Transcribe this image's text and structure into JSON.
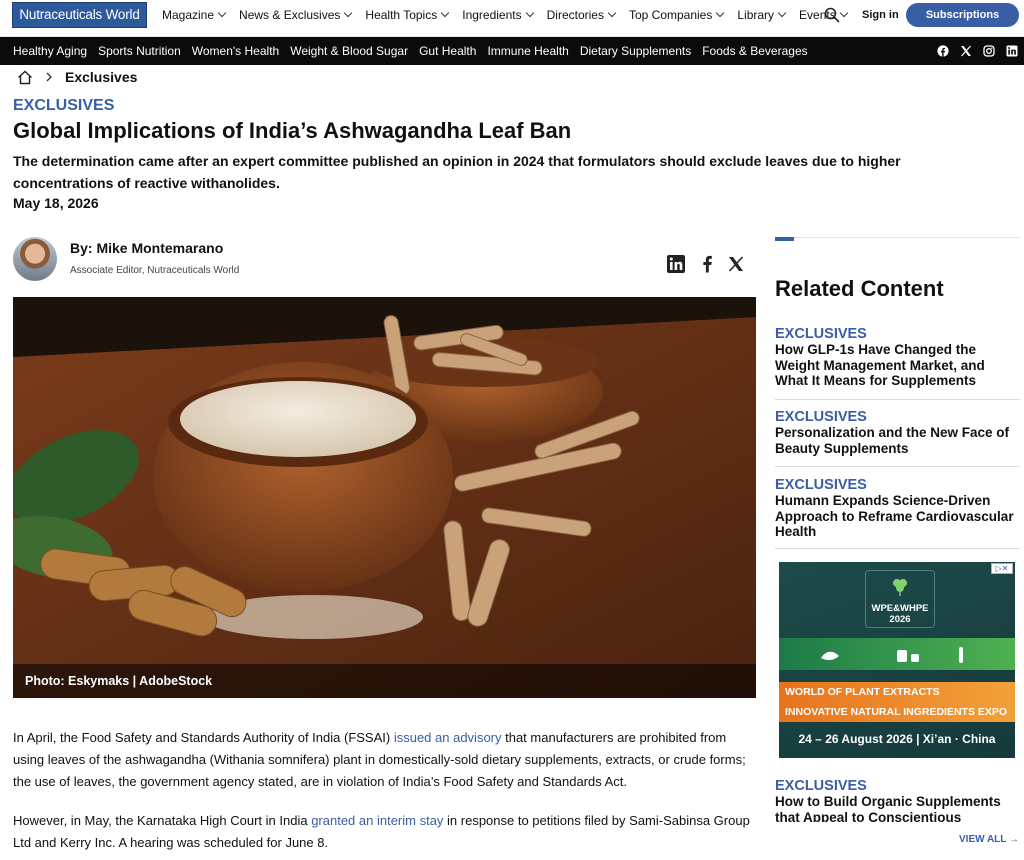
{
  "header": {
    "logo": "Nutraceuticals World",
    "nav": [
      "Magazine",
      "News & Exclusives",
      "Health Topics",
      "Ingredients",
      "Directories",
      "Top Companies",
      "Library",
      "Events"
    ],
    "signin": "Sign in",
    "subscribe": "Subscriptions"
  },
  "categories": [
    "Healthy Aging",
    "Sports Nutrition",
    "Women's Health",
    "Weight & Blood Sugar",
    "Gut Health",
    "Immune Health",
    "Dietary Supplements",
    "Foods & Beverages"
  ],
  "social": [
    "facebook-icon",
    "x-icon",
    "instagram-icon",
    "linkedin-icon"
  ],
  "breadcrumb": {
    "current": "Exclusives"
  },
  "article": {
    "kicker": "EXCLUSIVES",
    "title": "Global Implications of India’s Ashwagandha Leaf Ban",
    "dek": "The determination came after an expert committee published an opinion in 2024 that formulators should exclude leaves due to higher concentrations of reactive withanolides.",
    "date": "May 18, 2026",
    "author": "By: Mike Montemarano",
    "role": "Associate Editor, Nutraceuticals World",
    "caption": "Photo: Eskymaks | AdobeStock",
    "p1_a": "In April, the Food Safety and Standards Authority of India (FSSAI) ",
    "p1_link": "issued an advisory",
    "p1_b": " that manufacturers are prohibited from using leaves of the ashwagandha (Withania somnifera) plant in domestically-sold dietary supplements, extracts, or crude forms; the use of leaves, the government agency stated, are in violation of India’s Food Safety and Standards Act.",
    "p2_a": "However, in May, the Karnataka High Court in India ",
    "p2_link": "granted an interim stay",
    "p2_b": " in response to petitions filed by Sami-Sabinsa Group Ltd and Kerry Inc. A hearing was scheduled for June 8."
  },
  "sidebar": {
    "heading": "Related Content",
    "items": [
      {
        "kicker": "EXCLUSIVES",
        "title": "How GLP-1s Have Changed the Weight Management Market, and What It Means for Supplements"
      },
      {
        "kicker": "EXCLUSIVES",
        "title": "Personalization and the New Face of Beauty Supplements"
      },
      {
        "kicker": "EXCLUSIVES",
        "title": "Humann Expands Science-Driven Approach to Reframe Cardiovascular Health"
      },
      {
        "kicker": "EXCLUSIVES",
        "title": "How to Build Organic Supplements that Appeal to Conscientious"
      }
    ],
    "ad": {
      "logo": "WPE&WHPE 2026",
      "line1": "WORLD OF PLANT EXTRACTS",
      "line2": "INNOVATIVE NATURAL INGREDIENTS EXPO",
      "dates": "24 – 26 August 2026 | Xi’an · China"
    },
    "viewall": "VIEW ALL →"
  }
}
